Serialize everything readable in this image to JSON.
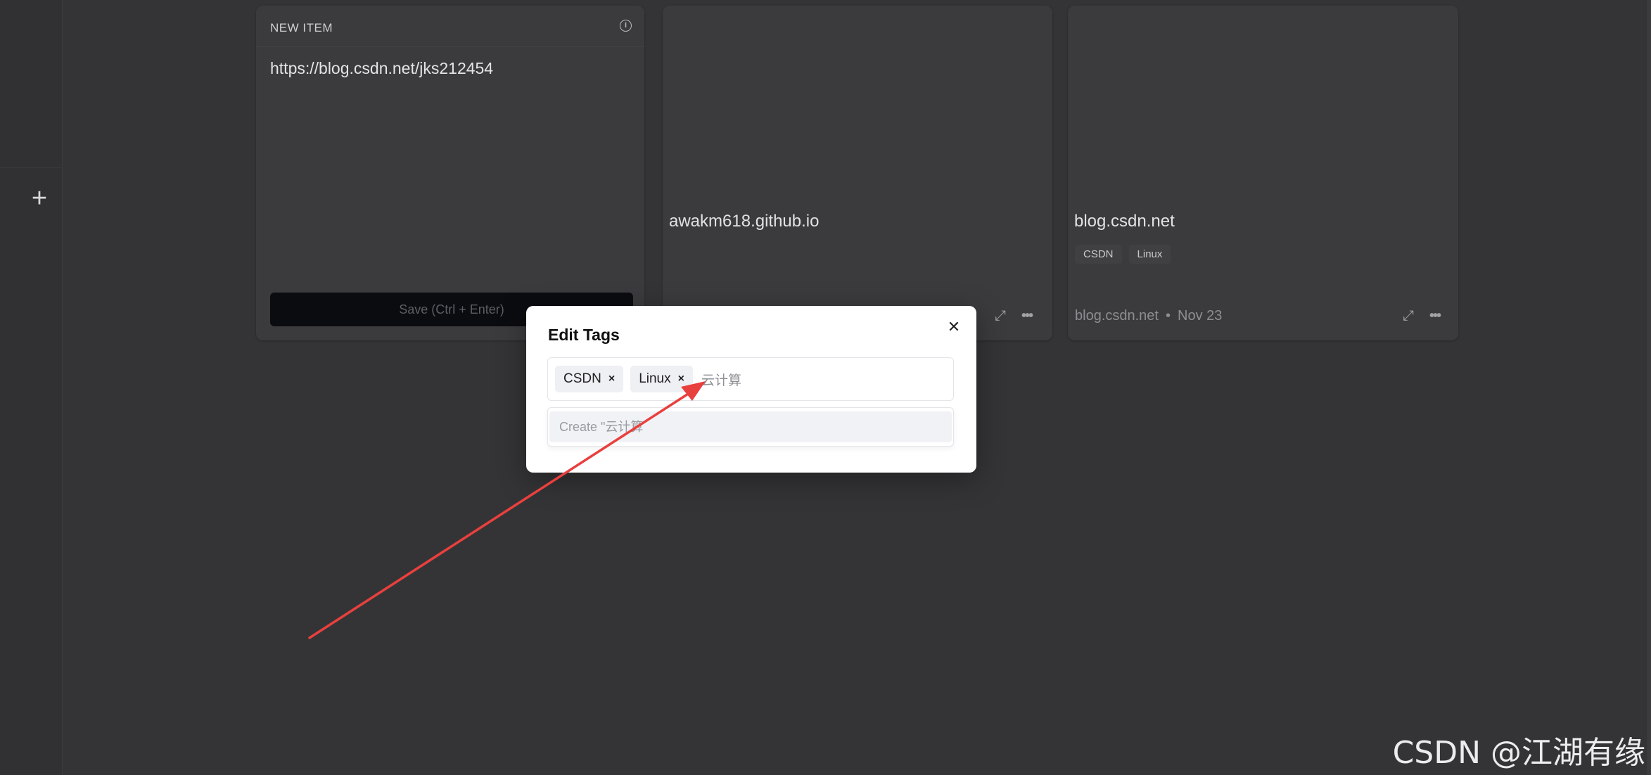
{
  "new_item": {
    "header": "NEW ITEM",
    "url_value": "https://blog.csdn.net/jks212454",
    "save_label": "Save (Ctrl + Enter)"
  },
  "cards": [
    {
      "domain": "awakm618.github.io"
    },
    {
      "domain": "blog.csdn.net",
      "tags": [
        "CSDN",
        "Linux"
      ],
      "footer_source": "blog.csdn.net",
      "footer_date": "Nov 23"
    }
  ],
  "modal": {
    "title": "Edit Tags",
    "chips": [
      "CSDN",
      "Linux"
    ],
    "input_value": "云计算",
    "suggestion": "Create \"云计算"
  },
  "watermark": "CSDN @江湖有缘",
  "colors": {
    "annotation_arrow": "#e8403e",
    "overlay": "#343436"
  }
}
